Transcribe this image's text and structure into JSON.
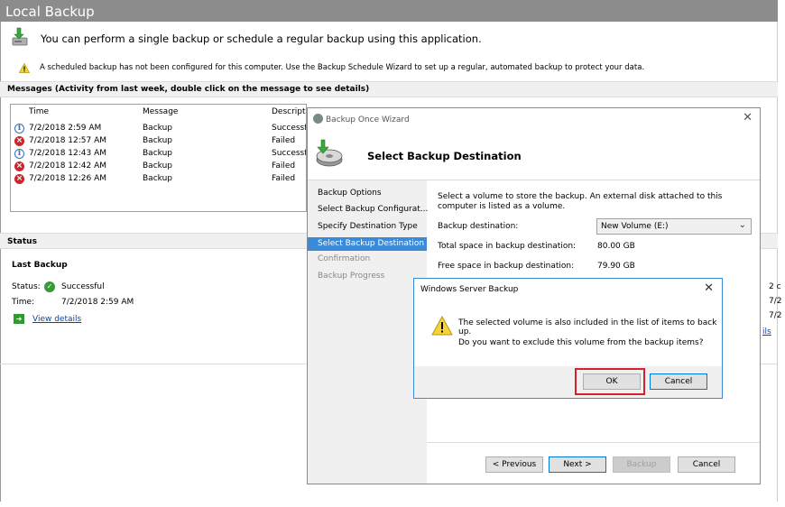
{
  "header": {
    "title": "Local Backup"
  },
  "intro": {
    "text": "You can perform a single backup or schedule a regular backup using this application."
  },
  "warning": {
    "text": "A scheduled backup has not been configured for this computer. Use the Backup Schedule Wizard to set up a regular, automated backup to protect your data."
  },
  "messages": {
    "header": "Messages (Activity from last week, double click on the message to see details)",
    "columns": [
      "Time",
      "Message",
      "Descriptio"
    ],
    "rows": [
      {
        "icon": "info-icon",
        "time": "7/2/2018 2:59 AM",
        "message": "Backup",
        "description": "Successful"
      },
      {
        "icon": "error-icon",
        "time": "7/2/2018 12:57 AM",
        "message": "Backup",
        "description": "Failed"
      },
      {
        "icon": "info-icon",
        "time": "7/2/2018 12:43 AM",
        "message": "Backup",
        "description": "Successful"
      },
      {
        "icon": "error-icon",
        "time": "7/2/2018 12:42 AM",
        "message": "Backup",
        "description": "Failed"
      },
      {
        "icon": "error-icon",
        "time": "7/2/2018 12:26 AM",
        "message": "Backup",
        "description": "Failed"
      }
    ]
  },
  "status": {
    "header": "Status",
    "last_backup_label": "Last Backup",
    "status_label": "Status:",
    "status_value": "Successful",
    "time_label": "Time:",
    "time_value": "7/2/2018 2:59 AM",
    "view_details": "View details"
  },
  "right_fragments": [
    "2 c",
    "7/2",
    "7/2",
    "ils"
  ],
  "wizard": {
    "title": "Backup Once Wizard",
    "heading": "Select Backup Destination",
    "nav": [
      {
        "label": "Backup Options",
        "state": "normal"
      },
      {
        "label": "Select Backup Configurat...",
        "state": "normal"
      },
      {
        "label": "Specify Destination Type",
        "state": "normal"
      },
      {
        "label": "Select Backup Destination",
        "state": "selected"
      },
      {
        "label": "Confirmation",
        "state": "disabled"
      },
      {
        "label": "Backup Progress",
        "state": "disabled"
      }
    ],
    "description": "Select a volume to store the backup. An external disk attached to this computer is listed as a volume.",
    "destination_label": "Backup destination:",
    "destination_value": "New Volume (E:)",
    "total_label": "Total space in backup destination:",
    "total_value": "80.00 GB",
    "free_label": "Free space in backup destination:",
    "free_value": "79.90 GB",
    "buttons": {
      "previous": "< Previous",
      "next": "Next >",
      "backup": "Backup",
      "cancel": "Cancel"
    }
  },
  "dialog": {
    "title": "Windows Server Backup",
    "line1": "The selected volume is also included in the list of items to back up.",
    "line2": "Do you want to exclude this volume from the backup items?",
    "ok": "OK",
    "cancel": "Cancel"
  },
  "colors": {
    "header_bg": "#8c8c8c",
    "nav_selected": "#3b8ad8",
    "error": "#c8282d",
    "highlight": "#d4212b",
    "link": "#0645ad"
  }
}
